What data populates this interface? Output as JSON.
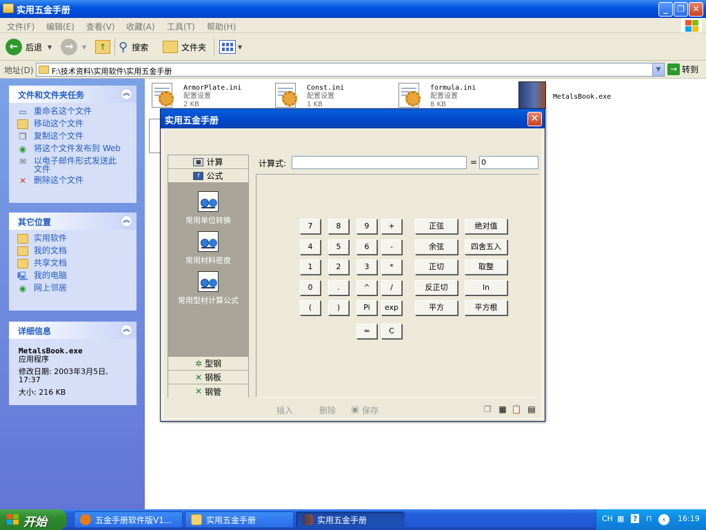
{
  "window": {
    "title": "实用五金手册"
  },
  "menu": [
    "文件(F)",
    "编辑(E)",
    "查看(V)",
    "收藏(A)",
    "工具(T)",
    "帮助(H)"
  ],
  "toolbar": {
    "back": "后退",
    "search": "搜索",
    "folders": "文件夹"
  },
  "address": {
    "label": "地址(D)",
    "path": "F:\\技术资料\\实用软件\\实用五金手册",
    "go": "转到"
  },
  "file_tasks": {
    "title": "文件和文件夹任务",
    "items": [
      "重命名这个文件",
      "移动这个文件",
      "复制这个文件",
      "将这个文件发布到 Web",
      "以电子邮件形式发送此文件",
      "删除这个文件"
    ]
  },
  "other_places": {
    "title": "其它位置",
    "items": [
      "实用软件",
      "我的文档",
      "共享文档",
      "我的电脑",
      "网上邻居"
    ]
  },
  "details": {
    "title": "详细信息",
    "filename": "MetalsBook.exe",
    "type": "应用程序",
    "modified": "修改日期: 2003年3月5日, 17:37",
    "size": "大小: 216 KB"
  },
  "files": [
    {
      "name": "ArmorPlate.ini",
      "type": "配置设置",
      "size": "2 KB"
    },
    {
      "name": "Const.ini",
      "type": "配置设置",
      "size": "1 KB"
    },
    {
      "name": "formula.ini",
      "type": "配置设置",
      "size": "8 KB"
    },
    {
      "name": "MetalsBook.exe"
    }
  ],
  "dialog": {
    "title": "实用五金手册",
    "nav_tabs_top": [
      "计算",
      "公式"
    ],
    "nav_items": [
      "常用单位转换",
      "常用材料密度",
      "常用型材计算公式"
    ],
    "nav_tabs_bottom": [
      "型钢",
      "钢板",
      "钢管"
    ],
    "expr_label": "计算式:",
    "expr_value": "",
    "equals": "=",
    "result": "0",
    "keys": {
      "r1": [
        "7",
        "8",
        "9",
        "+"
      ],
      "r2": [
        "4",
        "5",
        "6",
        "-"
      ],
      "r3": [
        "1",
        "2",
        "3",
        "*"
      ],
      "r4": [
        "0",
        ".",
        "^",
        "/"
      ],
      "r5": [
        "(",
        ")",
        "Pi",
        "exp"
      ],
      "r6": [
        "=",
        "C"
      ]
    },
    "func_keys": [
      [
        "正弦",
        "绝对值"
      ],
      [
        "余弦",
        "四舍五入"
      ],
      [
        "正切",
        "取整"
      ],
      [
        "反正切",
        "ln"
      ],
      [
        "平方",
        "平方根"
      ]
    ],
    "footer": {
      "insert": "插入",
      "delete": "删除",
      "save": "保存"
    }
  },
  "taskbar": {
    "start": "开始",
    "tasks": [
      "五金手册软件版V1...",
      "实用五金手册",
      "实用五金手册"
    ],
    "lang": "CH",
    "time": "16:19"
  }
}
